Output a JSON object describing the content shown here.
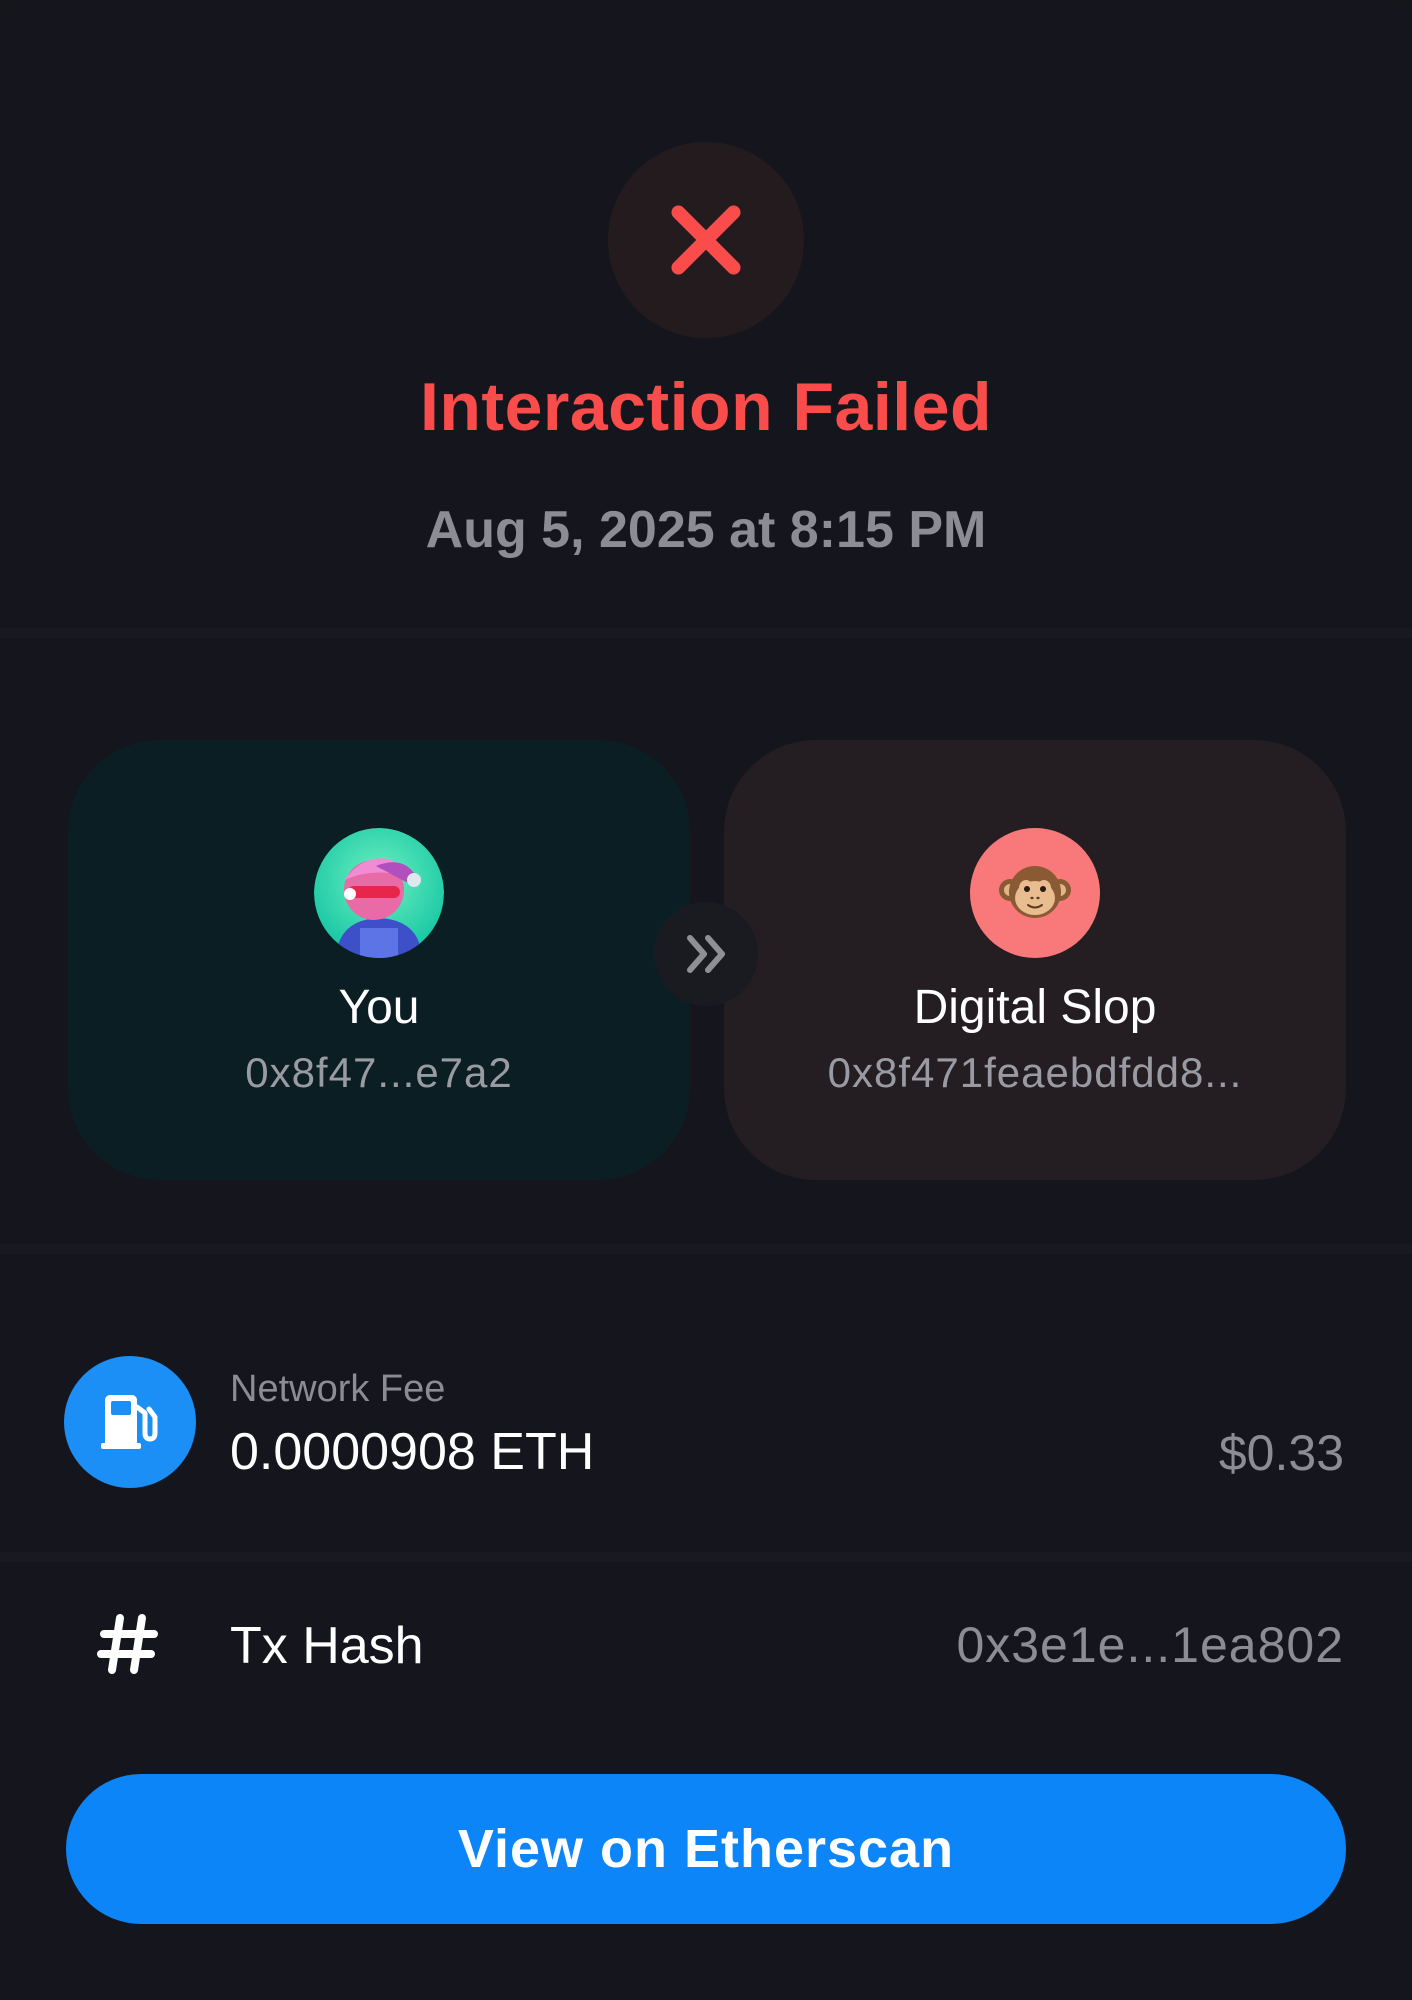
{
  "status": {
    "title": "Interaction Failed",
    "date": "Aug 5, 2025 at 8:15 PM",
    "icon": "close-icon",
    "color": "#fa4d4b"
  },
  "transfer": {
    "from": {
      "name": "You",
      "address": "0x8f47...e7a2",
      "avatar": "nft-avatar"
    },
    "to": {
      "name": "Digital Slop",
      "address": "0x8f471feaebdfdd8...",
      "avatar": "monkey-emoji"
    },
    "direction_icon": "double-chevron-right-icon"
  },
  "fee": {
    "label": "Network Fee",
    "amount": "0.0000908 ETH",
    "usd": "$0.33",
    "icon": "gas-pump-icon"
  },
  "tx": {
    "label": "Tx Hash",
    "value": "0x3e1e...1ea802",
    "icon": "hash-icon"
  },
  "actions": {
    "view_label": "View on Etherscan"
  },
  "colors": {
    "background": "#15161d",
    "accent": "#0c85f8",
    "error": "#fa4d4b",
    "fee_icon_bg": "#1b8ff5"
  }
}
